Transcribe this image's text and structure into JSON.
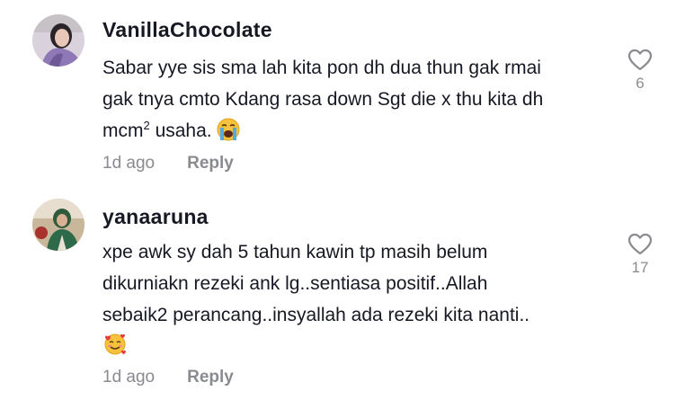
{
  "comments": [
    {
      "username": "VanillaChocolate",
      "lines": [
        "Sabar yye sis sma lah kita pon dh dua thun gak rmai",
        "gak tnya cmto Kdang rasa down Sgt die x thu kita dh"
      ],
      "line3_pre": "mcm",
      "line3_sup": "2",
      "line3_post": " usaha.",
      "emoji": "crying-face-emoji",
      "time": "1d ago",
      "reply": "Reply",
      "likes": "6"
    },
    {
      "username": "yanaaruna",
      "lines": [
        "xpe awk sy dah 5 tahun kawin tp masih belum",
        "dikurniakn rezeki ank lg..sentiasa positif..Allah",
        "sebaik2 perancang..insyallah ada rezeki kita nanti.."
      ],
      "emoji": "smiling-face-with-hearts-emoji",
      "time": "1d ago",
      "reply": "Reply",
      "likes": "17"
    }
  ],
  "colors": {
    "text": "#161823",
    "muted": "#8a8b91"
  }
}
